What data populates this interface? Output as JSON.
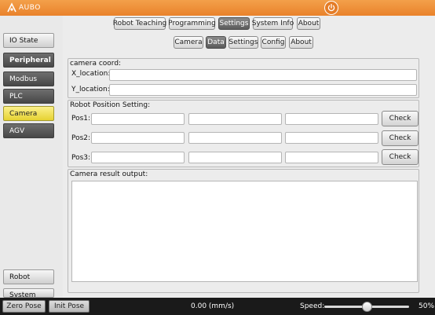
{
  "app": {
    "logo_text": "AUBO",
    "accent": "#e9822b"
  },
  "main_tabs": [
    {
      "label": "Robot Teaching",
      "active": false
    },
    {
      "label": "Programming",
      "active": false
    },
    {
      "label": "Settings",
      "active": true
    },
    {
      "label": "System Info",
      "active": false
    },
    {
      "label": "About",
      "active": false
    }
  ],
  "sub_tabs": [
    {
      "label": "Camera",
      "active": false
    },
    {
      "label": "Data",
      "active": true
    },
    {
      "label": "Settings",
      "active": false
    },
    {
      "label": "Config",
      "active": false
    },
    {
      "label": "About",
      "active": false
    }
  ],
  "sidebar": {
    "io_state": "IO State",
    "peripheral": "Peripheral",
    "items": [
      {
        "label": "Modbus",
        "active": false
      },
      {
        "label": "PLC",
        "active": false
      },
      {
        "label": "Camera",
        "active": true
      },
      {
        "label": "AGV",
        "active": false
      }
    ],
    "robot": "Robot",
    "system": "System"
  },
  "camera_coord": {
    "title": "camera coord:",
    "x_label": "X_location:",
    "x_value": "",
    "y_label": "Y_location:",
    "y_value": ""
  },
  "robot_position": {
    "title": "Robot Position Setting:",
    "rows": [
      {
        "label": "Pos1:",
        "values": [
          "",
          "",
          ""
        ],
        "button": "Check"
      },
      {
        "label": "Pos2:",
        "values": [
          "",
          "",
          ""
        ],
        "button": "Check"
      },
      {
        "label": "Pos3:",
        "values": [
          "",
          "",
          ""
        ],
        "button": "Check"
      }
    ]
  },
  "camera_result": {
    "title": "Camera result output:",
    "text": ""
  },
  "bottom": {
    "zero_pose": "Zero Pose",
    "init_pose": "Init Pose",
    "speed_readout": "0.00  (mm/s)",
    "speed_label": "Speed:",
    "speed_value": "50%",
    "speed_fraction": 0.5
  }
}
